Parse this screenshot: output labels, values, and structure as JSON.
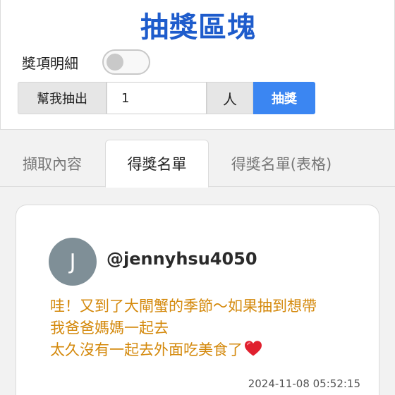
{
  "header": {
    "title": "抽獎區塊"
  },
  "settings": {
    "toggle_label": "獎項明細",
    "toggle_on": false
  },
  "draw": {
    "prefix_label": "幫我抽出",
    "count_value": "1",
    "suffix_label": "人",
    "button_label": "抽獎"
  },
  "tabs": [
    {
      "label": "擷取內容",
      "active": false
    },
    {
      "label": "得獎名單",
      "active": true
    },
    {
      "label": "得獎名單(表格)",
      "active": false
    }
  ],
  "winner": {
    "avatar_initial": "J",
    "username": "@jennyhsu4050",
    "comment_lines": [
      "哇！又到了大閘蟹的季節～如果抽到想帶",
      "我爸爸媽媽一起去",
      "太久沒有一起去外面吃美食了"
    ],
    "heart_icon": "red-heart-icon",
    "timestamp": "2024-11-08 05:52:15"
  },
  "colors": {
    "title": "#1e5ccc",
    "accent": "#3b86f2",
    "comment_text": "#d4890c",
    "avatar_bg": "#7f8f97",
    "heart": "#e0202e"
  }
}
